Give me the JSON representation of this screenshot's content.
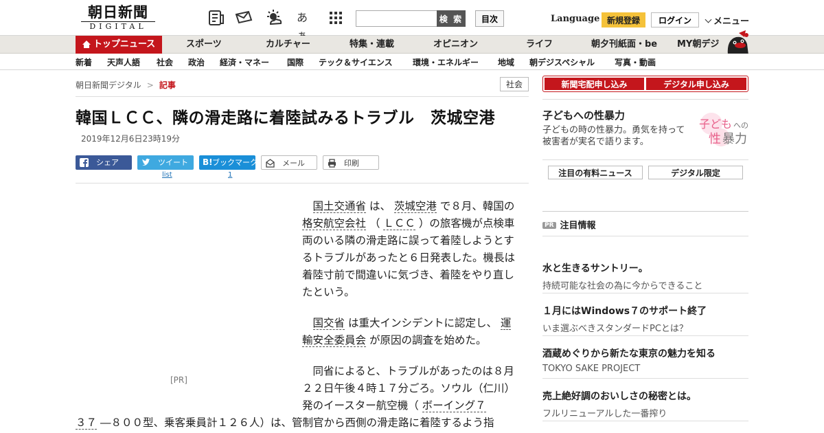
{
  "header": {
    "logo_text": "朝日新聞",
    "logo_sub": "DIGITAL",
    "search_button": "検 索",
    "toc_button": "目次",
    "language": "Language",
    "register": "新規登録",
    "login": "ログイン",
    "menu": "メニュー",
    "aa_icon_text": "あぁ"
  },
  "nav_primary": [
    "トップニュース",
    "スポーツ",
    "カルチャー",
    "特集・連載",
    "オピニオン",
    "ライフ",
    "朝夕刊紙面・be",
    "MY朝デジ"
  ],
  "nav_secondary": [
    "新着",
    "天声人語",
    "社会",
    "政治",
    "経済・マネー",
    "国際",
    "テック＆サイエンス",
    "環境・エネルギー",
    "地域",
    "朝デジスペシャル",
    "写真・動画"
  ],
  "breadcrumb": {
    "home": "朝日新聞デジタル",
    "sep": ">",
    "current": "記事"
  },
  "category_tag": "社会",
  "article": {
    "title": "韓国ＬＣＣ、隣の滑走路に着陸試みるトラブル　茨城空港",
    "date": "2019年12月6日23時19分",
    "ad_label": "[PR]",
    "p1": {
      "a": "国土交通省",
      "b": " は、 ",
      "c": "茨城空港",
      "d": " で８月、韓国の ",
      "e": "格安航空会社",
      "f": " （ ",
      "g": "ＬＣＣ",
      "h": " ）の旅客機が点検車両のいる隣の滑走路に誤って着陸しようとするトラブルがあったと６日発表した。機長は着陸寸前で間違いに気づき、着陸をやり直したという。"
    },
    "p2": {
      "a": "国交省",
      "b": " は重大インシデントに認定し、 ",
      "c": "運輸安全委員会",
      "d": " が原因の調査を始めた。"
    },
    "p3": {
      "a": "同省によると、トラブルがあったのは８月２２日午後４時１７分ごろ。ソウル（仁川）発のイースター航空機（ ",
      "b": "ボーイング７"
    },
    "p3b": {
      "a": "３７",
      "b": " ―８００型、乗客乗員計１２６人）は、管制官から西側の滑走路に着陸するよう指"
    }
  },
  "share": {
    "facebook": "シェア",
    "twitter": "ツイート",
    "twitter_count": "list",
    "hatena": "ブックマーク",
    "hatena_count": "1",
    "mail": "メール",
    "print": "印刷"
  },
  "sidebar": {
    "subscribe_paper": "新聞宅配申し込み",
    "subscribe_digital": "デジタル申し込み",
    "feature_title": "子どもへの性暴力",
    "feature_desc": "子どもの時の性暴力。勇気を持って被害者が実名で語ります。",
    "feature_logo_a": "子ども",
    "feature_logo_b": "への",
    "feature_logo_c": "性",
    "feature_logo_d": "暴力",
    "tab_paid": "注目の有料ニュース",
    "tab_digital": "デジタル限定",
    "pr_badge": "PR",
    "pr_heading": "注目情報",
    "pr_items": [
      {
        "title": "水と生きるサントリー。",
        "sub": "持続可能な社会の為に今からできること"
      },
      {
        "title": "１月にはWindows７のサポート終了",
        "sub": "いま選ぶべきスタンダードPCとは？"
      },
      {
        "title": "酒蔵めぐりから新たな東京の魅力を知る",
        "sub": "TOKYO SAKE PROJECT"
      },
      {
        "title": "売上絶好調のおいしさの秘密とは。",
        "sub": "フルリニューアルした一番搾り"
      }
    ]
  },
  "colors": {
    "brand_red": "#c4161c",
    "register_yellow": "#f5c23a",
    "facebook": "#3b5998",
    "twitter": "#3fa9e0",
    "hatena": "#1a8fd8"
  }
}
